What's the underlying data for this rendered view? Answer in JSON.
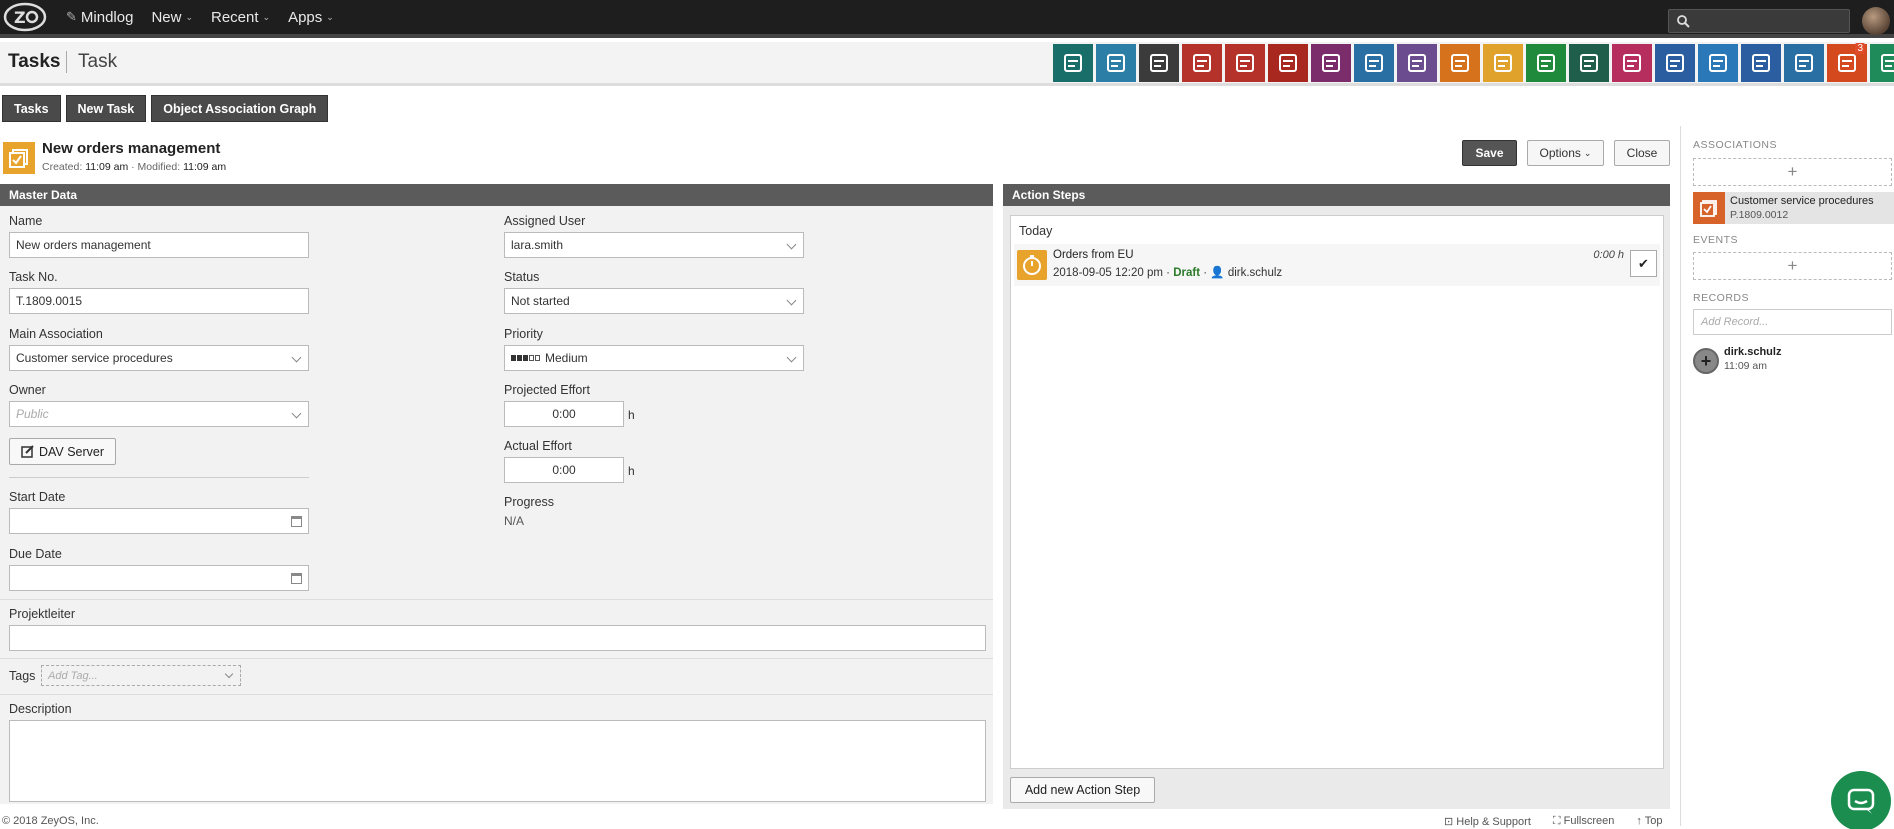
{
  "nav": {
    "items": [
      {
        "label": "Mindlog"
      },
      {
        "label": "New"
      },
      {
        "label": "Recent"
      },
      {
        "label": "Apps"
      }
    ],
    "search_placeholder": ""
  },
  "header": {
    "section": "Tasks",
    "page": "Task",
    "apps": [
      {
        "icon": "billing-icon",
        "color": "#1a6e6a"
      },
      {
        "icon": "mail-icon",
        "color": "#2b7fa6"
      },
      {
        "icon": "contacts-icon",
        "color": "#3b3b3b"
      },
      {
        "icon": "tasks-icon",
        "color": "#b5322b"
      },
      {
        "icon": "documents-icon",
        "color": "#b5322b"
      },
      {
        "icon": "calendar-icon",
        "color": "#a8281f"
      },
      {
        "icon": "projects-icon",
        "color": "#7a2c6b"
      },
      {
        "icon": "address-book-icon",
        "color": "#2a6fa3"
      },
      {
        "icon": "handshake-icon",
        "color": "#6b4c8f"
      },
      {
        "icon": "timer-icon",
        "color": "#d6721c"
      },
      {
        "icon": "checklist-icon",
        "color": "#e0a22a"
      },
      {
        "icon": "notes-icon",
        "color": "#1f8a3c"
      },
      {
        "icon": "shipping-icon",
        "color": "#1f5e4a"
      },
      {
        "icon": "cashier-icon",
        "color": "#b52e5e"
      },
      {
        "icon": "dollar-icon",
        "color": "#2a5ea0"
      },
      {
        "icon": "truck-icon",
        "color": "#2a78b8"
      },
      {
        "icon": "bookmark-icon",
        "color": "#2a5ea0"
      },
      {
        "icon": "support-icon",
        "color": "#2a6fa3"
      },
      {
        "icon": "broadcast-icon",
        "color": "#d44a1e",
        "badge": "3"
      },
      {
        "icon": "download-icon",
        "color": "#1f8a5a"
      }
    ]
  },
  "toolbar": {
    "tasks": "Tasks",
    "new_task": "New Task",
    "graph": "Object Association Graph"
  },
  "record": {
    "title": "New orders management",
    "created_label": "Created:",
    "created": "11:09 am",
    "modified_label": "· Modified:",
    "modified": "11:09 am",
    "save": "Save",
    "options": "Options",
    "close": "Close"
  },
  "master": {
    "heading": "Master Data",
    "name_label": "Name",
    "name_value": "New orders management",
    "taskno_label": "Task No.",
    "taskno_value": "T.1809.0015",
    "main_assoc_label": "Main Association",
    "main_assoc_value": "Customer service procedures",
    "owner_label": "Owner",
    "owner_placeholder": "Public",
    "dav_button": "DAV Server",
    "start_label": "Start Date",
    "due_label": "Due Date",
    "assigned_label": "Assigned User",
    "assigned_value": "lara.smith",
    "status_label": "Status",
    "status_value": "Not started",
    "priority_label": "Priority",
    "priority_value": "Medium",
    "priority_level": 3,
    "priority_max": 5,
    "proj_effort_label": "Projected Effort",
    "proj_effort_value": "0:00",
    "actual_effort_label": "Actual Effort",
    "actual_effort_value": "0:00",
    "effort_unit": "h",
    "progress_label": "Progress",
    "progress_value": "N/A",
    "projektleiter_label": "Projektleiter",
    "tags_label": "Tags",
    "tags_placeholder": "Add Tag...",
    "description_label": "Description"
  },
  "actions": {
    "heading": "Action Steps",
    "group": "Today",
    "steps": [
      {
        "title": "Orders from EU",
        "date": "2018-09-05 12:20 pm ·",
        "status": "Draft",
        "user": "dirk.schulz",
        "time": "0:00 h"
      }
    ],
    "add_button": "Add new Action Step"
  },
  "sidebar": {
    "associations": "ASSOCIATIONS",
    "assoc_title": "Customer service procedures",
    "assoc_no": "P.1809.0012",
    "events": "EVENTS",
    "records": "RECORDS",
    "add_record_placeholder": "Add Record...",
    "record_user": "dirk.schulz",
    "record_time": "11:09 am"
  },
  "footer": {
    "copyright": "© 2018 ZeyOS, Inc.",
    "help": "Help & Support",
    "fullscreen": "Fullscreen",
    "top": "Top"
  }
}
